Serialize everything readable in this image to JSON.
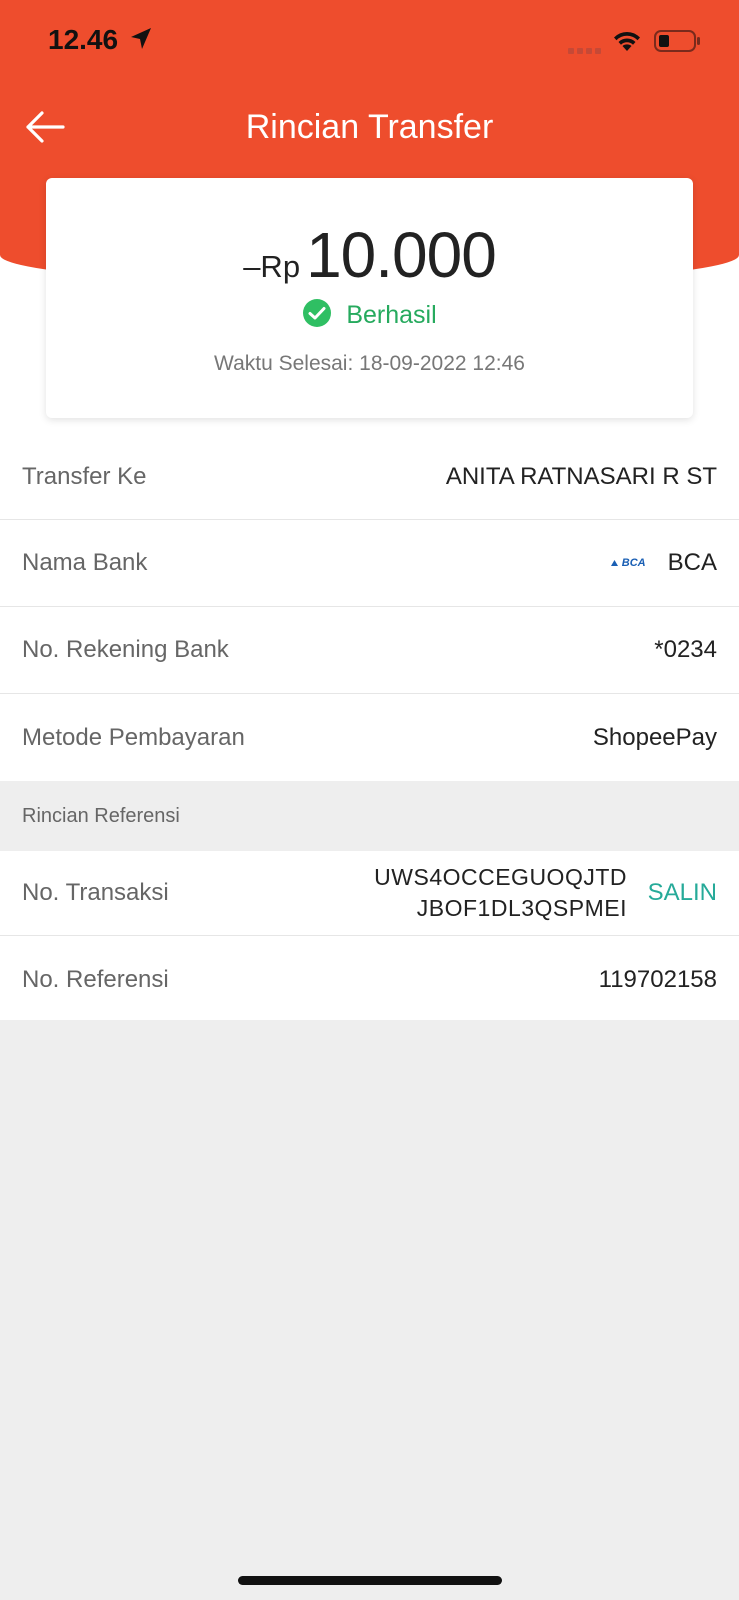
{
  "status_bar": {
    "time": "12.46",
    "icons": [
      "location-arrow-icon",
      "signal-icon",
      "wifi-icon",
      "battery-icon"
    ]
  },
  "header": {
    "title": "Rincian Transfer",
    "back_icon": "arrow-left-icon",
    "color": "#ee4d2d"
  },
  "summary": {
    "amount_prefix": "–Rp",
    "amount": "10.000",
    "status": "Berhasil",
    "status_color": "#26aa5e",
    "completed_time": "Waktu Selesai: 18-09-2022 12:46"
  },
  "details": [
    {
      "label": "Transfer Ke",
      "value": "ANITA RATNASARI R ST"
    },
    {
      "label": "Nama Bank",
      "value": "BCA",
      "logo_text": "BCA"
    },
    {
      "label": "No. Rekening Bank",
      "value": "*0234"
    },
    {
      "label": "Metode Pembayaran",
      "value": "ShopeePay"
    }
  ],
  "reference_section": {
    "title": "Rincian Referensi",
    "transaction": {
      "label": "No. Transaksi",
      "line1": "UWS4OCCEGUOQJTD",
      "line2": "JBOF1DL3QSPMEI",
      "copy_label": "SALIN"
    },
    "reference": {
      "label": "No. Referensi",
      "value": "119702158"
    }
  }
}
